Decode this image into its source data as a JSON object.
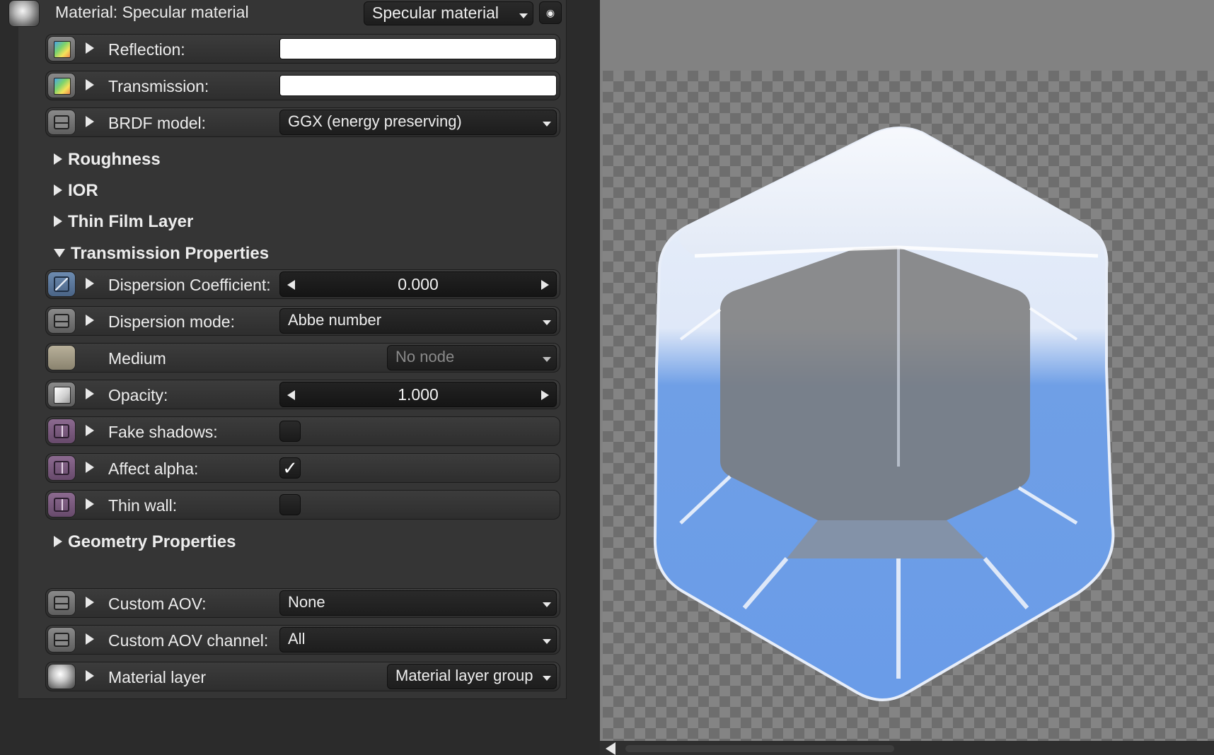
{
  "header": {
    "title": "Material: Specular material",
    "type_dropdown": "Specular material"
  },
  "rows": {
    "reflection": {
      "label": "Reflection:",
      "color": "#ffffff"
    },
    "transmission": {
      "label": "Transmission:",
      "color": "#ffffff"
    },
    "brdf": {
      "label": "BRDF model:",
      "value": "GGX (energy preserving)"
    },
    "dispersion_coeff": {
      "label": "Dispersion Coefficient:",
      "value": "0.000"
    },
    "dispersion_mode": {
      "label": "Dispersion mode:",
      "value": "Abbe number"
    },
    "medium": {
      "label": "Medium",
      "value": "No node"
    },
    "opacity": {
      "label": "Opacity:",
      "value": "1.000"
    },
    "fake_shadows": {
      "label": "Fake shadows:",
      "checked": false
    },
    "affect_alpha": {
      "label": "Affect alpha:",
      "checked": true,
      "mark": "✓"
    },
    "thin_wall": {
      "label": "Thin wall:",
      "checked": false
    },
    "custom_aov": {
      "label": "Custom AOV:",
      "value": "None"
    },
    "custom_aov_channel": {
      "label": "Custom AOV channel:",
      "value": "All"
    },
    "material_layer": {
      "label": "Material layer",
      "value": "Material layer group"
    }
  },
  "sections": {
    "roughness": "Roughness",
    "ior": "IOR",
    "thin_film": "Thin Film Layer",
    "transmission_props": "Transmission Properties",
    "geometry_props": "Geometry Properties"
  },
  "icons": {
    "node": "material-node-icon",
    "eye": "eye-icon",
    "texture_pin": "texture-pin-icon",
    "enum_pin": "enum-pin-icon",
    "float_pin": "float-pin-icon",
    "bool_pin": "bool-pin-icon"
  },
  "colors": {
    "panel_bg": "#353535",
    "viewport_bg": "#828282",
    "glass_tint": "#6f9fe6"
  }
}
